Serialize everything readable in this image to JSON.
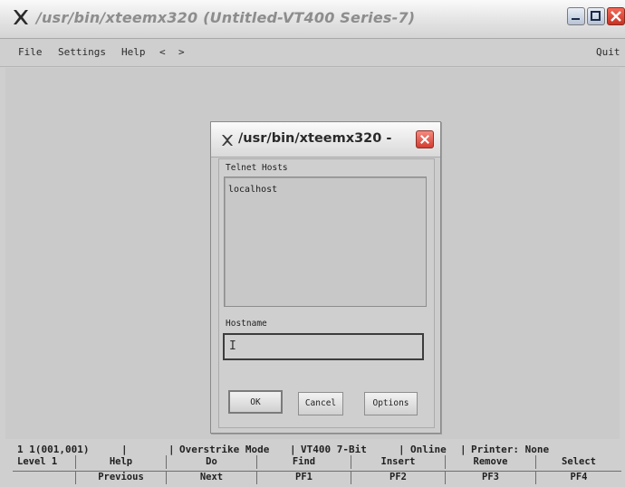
{
  "window": {
    "title": "/usr/bin/xteemx320 (Untitled-VT400 Series-7)"
  },
  "menubar": {
    "file": "File",
    "settings": "Settings",
    "help": "Help",
    "back": "<",
    "forward": ">",
    "quit": "Quit"
  },
  "dialog": {
    "title": "/usr/bin/xteemx320 -",
    "hosts_label": "Telnet Hosts",
    "hosts": [
      "localhost"
    ],
    "hostname_label": "Hostname",
    "hostname_value": "I",
    "ok": "OK",
    "cancel": "Cancel",
    "options": "Options"
  },
  "status": {
    "position": "1 1(001,001)",
    "mode": "Overstrike Mode",
    "terminal": "VT400 7-Bit",
    "connection": "Online",
    "printer": "Printer: None"
  },
  "keys": {
    "row1": [
      "Level 1",
      "Help",
      "Do",
      "Find",
      "Insert",
      "Remove",
      "Select"
    ],
    "row2": [
      "",
      "Previous",
      "Next",
      "PF1",
      "PF2",
      "PF3",
      "PF4"
    ]
  }
}
